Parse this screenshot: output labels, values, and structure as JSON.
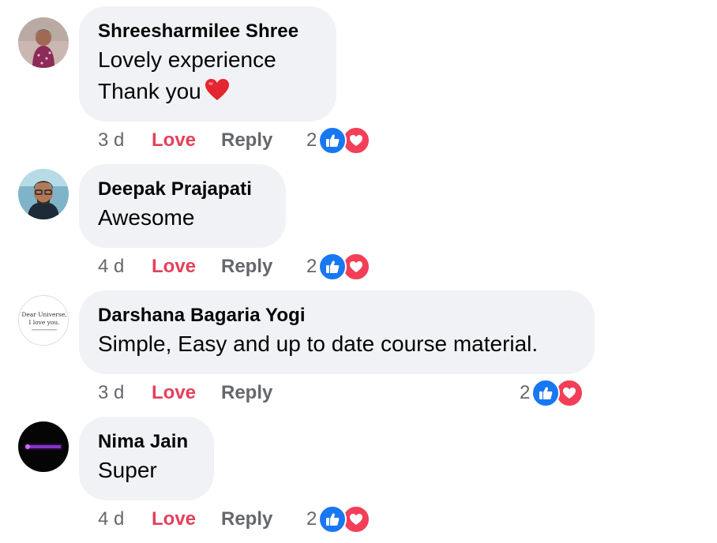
{
  "comments": [
    {
      "author": "Shreesharmilee Shree",
      "lines": [
        "Lovely experience",
        "Thank you"
      ],
      "time": "3 d",
      "love_label": "Love",
      "reply_label": "Reply",
      "reaction_count": "2"
    },
    {
      "author": "Deepak Prajapati",
      "lines": [
        "Awesome"
      ],
      "time": "4 d",
      "love_label": "Love",
      "reply_label": "Reply",
      "reaction_count": "2"
    },
    {
      "author": "Darshana Bagaria Yogi",
      "lines": [
        "Simple, Easy and up to date course material."
      ],
      "time": "3 d",
      "love_label": "Love",
      "reply_label": "Reply",
      "reaction_count": "2",
      "avatar_text": [
        "Dear Universe,",
        "I love you."
      ]
    },
    {
      "author": "Nima Jain",
      "lines": [
        "Super"
      ],
      "time": "4 d",
      "love_label": "Love",
      "reply_label": "Reply",
      "reaction_count": "2"
    }
  ],
  "colors": {
    "love": "#e4405a",
    "meta": "#65676b",
    "bubble": "#f0f2f5",
    "like_icon": "#1877f2",
    "heart_icon": "#f33e58"
  },
  "icons": [
    "like-icon",
    "heart-reaction-icon",
    "red-heart-emoji-icon"
  ]
}
